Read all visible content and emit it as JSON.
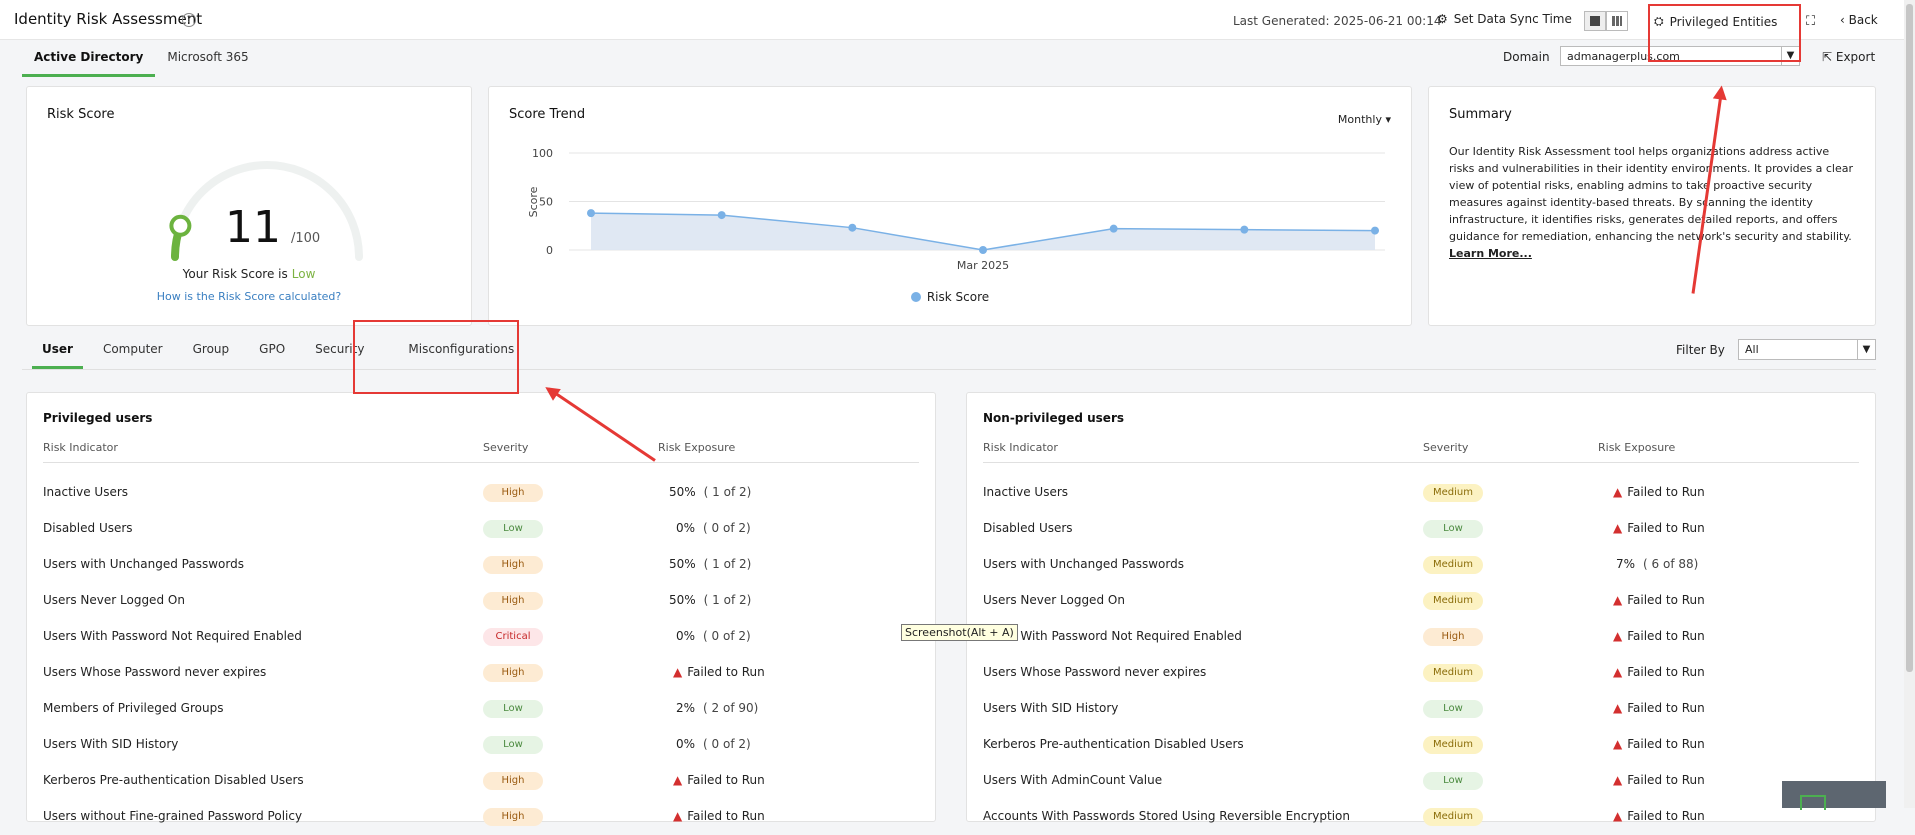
{
  "header": {
    "title": "Identity Risk Assessment",
    "last_generated": "Last Generated: 2025-06-21 00:14",
    "sync_label": "Set Data Sync Time",
    "privileged_label": "Privileged Entities",
    "back_label": "Back"
  },
  "top_tabs": [
    "Active Directory",
    "Microsoft 365"
  ],
  "domain": {
    "label": "Domain",
    "value": "admanagerplus.com"
  },
  "export_label": "Export",
  "risk_score": {
    "title": "Risk Score",
    "score": "11",
    "max": "/100",
    "label": "Your Risk Score is",
    "level": "Low",
    "link": "How is the Risk Score calculated?",
    "fraction": 0.11
  },
  "trend": {
    "title": "Score Trend",
    "period": "Monthly",
    "legend": "Risk Score"
  },
  "chart_data": {
    "type": "area",
    "title": "Score Trend",
    "ylabel": "Score",
    "ylim": [
      0,
      100
    ],
    "yticks": [
      "0",
      "50",
      "100"
    ],
    "x_tick_label": "Mar 2025",
    "series": [
      {
        "name": "Risk Score",
        "values": [
          38,
          36,
          23,
          0,
          22,
          21,
          20
        ]
      }
    ],
    "colors": {
      "line": "#7ab1e6",
      "fill": "#dde6f2"
    },
    "grid": true,
    "legend": "bottom"
  },
  "summary": {
    "title": "Summary",
    "text": "Our Identity Risk Assessment tool helps organizations address active risks and vulnerabilities in their identity environments. It provides a clear view of potential risks, enabling admins to take proactive security measures against identity-based threats. By scanning the identity infrastructure, it identifies risks, generates detailed reports, and offers guidance for remediation, enhancing the network's security and stability.",
    "link": "Learn More..."
  },
  "sub_tabs": [
    "User",
    "Computer",
    "Group",
    "GPO",
    "Security",
    "Misconfigurations"
  ],
  "filter": {
    "label": "Filter By",
    "value": "All"
  },
  "tables": [
    {
      "title": "Privileged users",
      "headers": [
        "Risk Indicator",
        "Severity",
        "Risk Exposure"
      ],
      "rows": [
        {
          "name": "Inactive Users",
          "severity": "High",
          "exposure": "50%",
          "count": "( 1 of 2)"
        },
        {
          "name": "Disabled Users",
          "severity": "Low",
          "exposure": "0%",
          "count": "( 0 of 2)"
        },
        {
          "name": "Users with Unchanged Passwords",
          "severity": "High",
          "exposure": "50%",
          "count": "( 1 of 2)"
        },
        {
          "name": "Users Never Logged On",
          "severity": "High",
          "exposure": "50%",
          "count": "( 1 of 2)"
        },
        {
          "name": "Users With Password Not Required Enabled",
          "severity": "Critical",
          "exposure": "0%",
          "count": "( 0 of 2)"
        },
        {
          "name": "Users Whose Password never expires",
          "severity": "High",
          "exposure": "Failed to Run",
          "count": ""
        },
        {
          "name": "Members of Privileged Groups",
          "severity": "Low",
          "exposure": "2%",
          "count": "( 2 of 90)"
        },
        {
          "name": "Users With SID History",
          "severity": "Low",
          "exposure": "0%",
          "count": "( 0 of 2)"
        },
        {
          "name": "Kerberos Pre-authentication Disabled Users",
          "severity": "High",
          "exposure": "Failed to Run",
          "count": ""
        },
        {
          "name": "Users without Fine-grained Password Policy",
          "severity": "High",
          "exposure": "Failed to Run",
          "count": ""
        }
      ]
    },
    {
      "title": "Non-privileged users",
      "headers": [
        "Risk Indicator",
        "Severity",
        "Risk Exposure"
      ],
      "rows": [
        {
          "name": "Inactive Users",
          "severity": "Medium",
          "exposure": "Failed to Run",
          "count": ""
        },
        {
          "name": "Disabled Users",
          "severity": "Low",
          "exposure": "Failed to Run",
          "count": ""
        },
        {
          "name": "Users with Unchanged Passwords",
          "severity": "Medium",
          "exposure": "7%",
          "count": "( 6 of 88)"
        },
        {
          "name": "Users Never Logged On",
          "severity": "Medium",
          "exposure": "Failed to Run",
          "count": ""
        },
        {
          "name": "Users With Password Not Required Enabled",
          "severity": "High",
          "exposure": "Failed to Run",
          "count": ""
        },
        {
          "name": "Users Whose Password never expires",
          "severity": "Medium",
          "exposure": "Failed to Run",
          "count": ""
        },
        {
          "name": "Users With SID History",
          "severity": "Low",
          "exposure": "Failed to Run",
          "count": ""
        },
        {
          "name": "Kerberos Pre-authentication Disabled Users",
          "severity": "Medium",
          "exposure": "Failed to Run",
          "count": ""
        },
        {
          "name": "Users With AdminCount Value",
          "severity": "Low",
          "exposure": "Failed to Run",
          "count": ""
        },
        {
          "name": "Accounts With Passwords Stored Using Reversible Encryption",
          "severity": "Medium",
          "exposure": "Failed to Run",
          "count": ""
        }
      ]
    }
  ],
  "tooltip": "Screenshot(Alt + A)"
}
